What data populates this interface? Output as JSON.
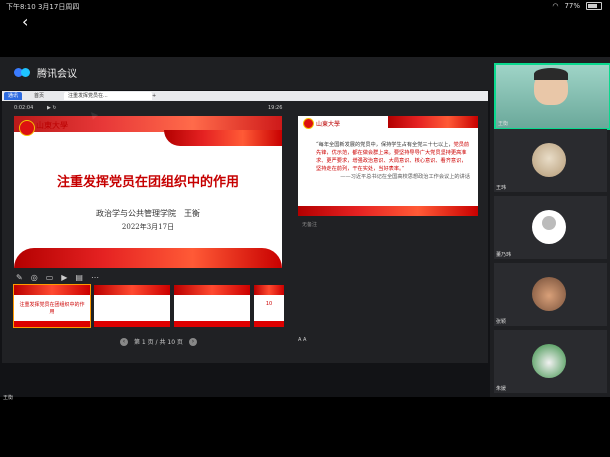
{
  "status": {
    "time": "下午8:10",
    "date": "3月17日周四",
    "battery": "77%"
  },
  "app": {
    "name": "腾讯会议"
  },
  "browser": {
    "tabs": [
      {
        "label": "通讯"
      },
      {
        "label": "首页"
      },
      {
        "label": "注重发挥党员在..."
      }
    ]
  },
  "ppt": {
    "timer_left": "0:02:04",
    "timer_right": "19:26",
    "main_slide": {
      "title": "注重发挥党员在团组织中的作用",
      "line1": "政治学与公共管理学院　王衡",
      "line2": "2022年3月17日"
    },
    "next_slide": {
      "quote_a": "“每年全国新发展的党员中，保持学生占有全党三十七以上，",
      "quote_b": "党员前先锋，优示范，都在做会群上来。要坚持导导广大党员坚持更高准求、更严要求，增强政治意识、大局意识、核心意识、看齐意识，坚持走在前列，干在实处，当好表率。”",
      "source": "——习近平总书记在全国高校思想政治工作会议上的讲话"
    },
    "next_label": "无备注",
    "thumb_titles": [
      "注重发挥党员在团组织中的作用",
      "",
      "",
      "10"
    ],
    "pager": "第 1 页 / 共 10 页"
  },
  "sharer": "王衡",
  "participants": [
    {
      "name": "王衡"
    },
    {
      "name": "王玮"
    },
    {
      "name": "董乃玮"
    },
    {
      "name": "张颖"
    },
    {
      "name": "朱媛"
    }
  ]
}
